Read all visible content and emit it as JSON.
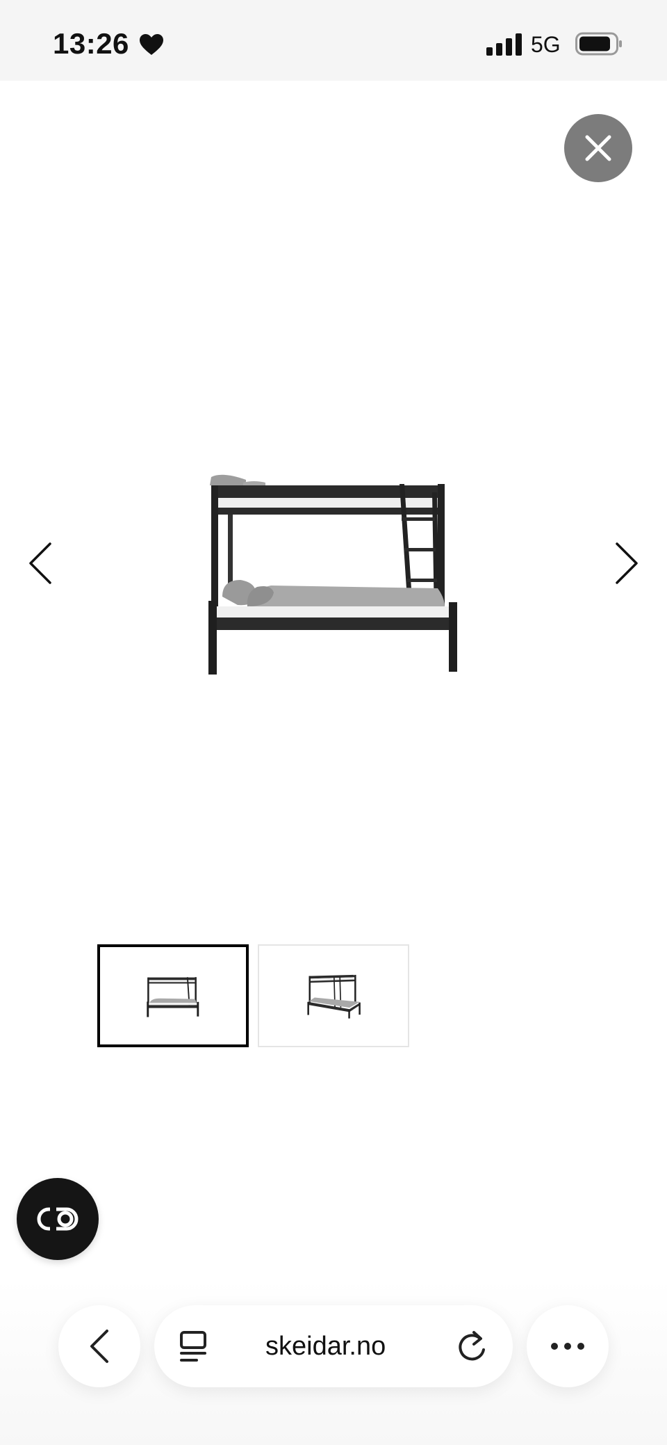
{
  "status_bar": {
    "time": "13:26",
    "network": "5G"
  },
  "viewer": {
    "close_icon": "close-icon",
    "prev_icon": "chevron-left-icon",
    "next_icon": "chevron-right-icon",
    "images": [
      "bunk-bed-front",
      "bunk-bed-angle"
    ],
    "selected_index": 0
  },
  "fab": {
    "icon": "link-toggle-icon"
  },
  "browser_toolbar": {
    "back_icon": "chevron-left-icon",
    "reader_icon": "reader-icon",
    "url": "skeidar.no",
    "reload_icon": "reload-icon",
    "more_icon": "more-icon"
  },
  "colors": {
    "close_button_bg": "#7c7c7c",
    "fab_bg": "#151515",
    "selected_thumb_border": "#000000",
    "bed_frame": "#2b2b2b",
    "bedding": "#a9a9a9"
  }
}
